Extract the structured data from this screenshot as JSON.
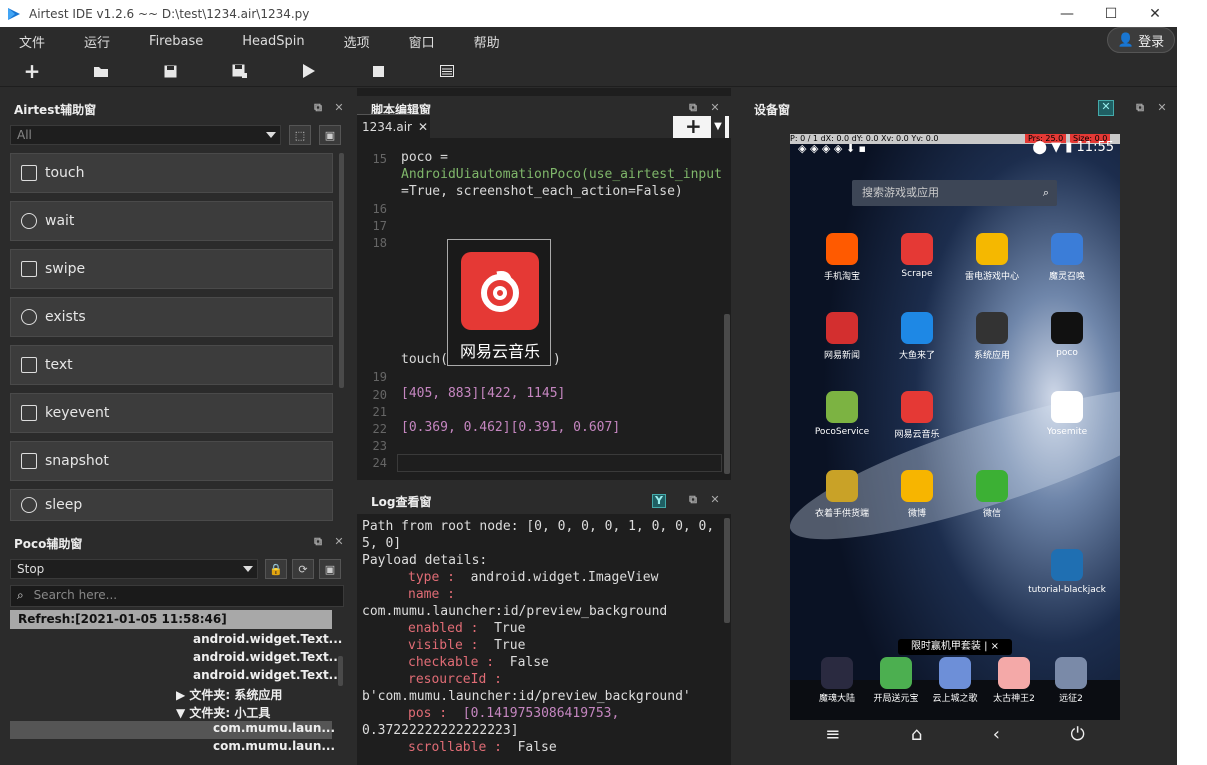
{
  "window": {
    "title": "Airtest IDE v1.2.6 ~~ D:\\test\\1234.air\\1234.py"
  },
  "menu": {
    "items": [
      "文件",
      "运行",
      "Firebase",
      "HeadSpin",
      "选项",
      "窗口",
      "帮助"
    ],
    "login": "登录"
  },
  "toolbar": {
    "icons": [
      "plus-icon",
      "folder-icon",
      "save-icon",
      "save-as-icon",
      "play-icon",
      "stop-icon",
      "list-icon"
    ]
  },
  "airtest_panel": {
    "title": "Airtest辅助窗",
    "filter": "All",
    "commands": [
      "touch",
      "wait",
      "swipe",
      "exists",
      "text",
      "keyevent",
      "snapshot",
      "sleep"
    ]
  },
  "poco_panel": {
    "title": "Poco辅助窗",
    "mode": "Stop",
    "search_placeholder": "Search here...",
    "refresh": "Refresh:[2021-01-05 11:58:46]",
    "tree": [
      "android.widget.Text...",
      "android.widget.Text...",
      "android.widget.Text...",
      "文件夹: 系统应用",
      "文件夹: 小工具",
      "com.mumu.laun...",
      "com.mumu.laun..."
    ]
  },
  "editor": {
    "title": "脚本编辑窗",
    "tab": "1234.air",
    "line_numbers": [
      "15",
      "16",
      "17",
      "18",
      "19",
      "20",
      "21",
      "22",
      "23",
      "24"
    ],
    "line15a": "poco =",
    "line15b": "AndroidUiautomationPoco(use_airtest_input",
    "line15c": "=True, screenshot_each_action=False)",
    "touch_call": "touch(",
    "touch_close": ")",
    "image_label": "网易云音乐",
    "line20": "[405, 883][422, 1145]",
    "line22": "[0.369, 0.462][0.391, 0.607]"
  },
  "log": {
    "title": "Log查看窗",
    "lines": [
      "Path from root node: [0, 0, 0, 0, 1, 0, 0, 0,",
      "5, 0]",
      "Payload details:"
    ],
    "type_key": "type :",
    "type_val": "android.widget.ImageView",
    "name_key": "name :",
    "name_val": "com.mumu.launcher:id/preview_background",
    "enabled_key": "enabled :",
    "enabled_val": "True",
    "visible_key": "visible :",
    "visible_val": "True",
    "checkable_key": "checkable :",
    "checkable_val": "False",
    "resource_key": "resourceId :",
    "resource_val": "b'com.mumu.launcher:id/preview_background'",
    "pos_key": "pos :",
    "pos_val": "[0.1419753086419753,",
    "pos_val2": "0.37222222222222223]",
    "scroll_key": "scrollable :",
    "scroll_val": "False"
  },
  "device": {
    "title": "设备窗",
    "debug": "P: 0 / 1   dX: 0.0   dY: 0.0   Xv: 0.0   Yv: 0.0",
    "prs": "Prs: 25.0",
    "size": "Size: 0.0",
    "clock": "11:55",
    "search_placeholder": "搜索游戏或应用",
    "apps": [
      {
        "label": "手机淘宝",
        "color": "#ff5a00"
      },
      {
        "label": "Scrape",
        "color": "#e53935"
      },
      {
        "label": "雷电游戏中心",
        "color": "#f5b800"
      },
      {
        "label": "魔灵召唤",
        "color": "#3b7dd8"
      },
      {
        "label": "网易新闻",
        "color": "#d32f2f"
      },
      {
        "label": "大鱼来了",
        "color": "#1e88e5"
      },
      {
        "label": "系统应用",
        "color": "#333333"
      },
      {
        "label": "poco",
        "color": "#111111"
      },
      {
        "label": "PocoService",
        "color": "#7cb342"
      },
      {
        "label": "网易云音乐",
        "color": "#e53935"
      },
      {
        "label": "",
        "color": "#111111"
      },
      {
        "label": "Yosemite",
        "color": "#ffffff"
      },
      {
        "label": "衣着手供货端",
        "color": "#c9a227"
      },
      {
        "label": "微博",
        "color": "#f7b500"
      },
      {
        "label": "微信",
        "color": "#3cb034"
      },
      {
        "label": "tutorial-blackjack",
        "color": "#1f6fb2"
      }
    ],
    "banner": "限时赢机甲套装  |  ×",
    "dock": [
      {
        "label": "魔魂大陆",
        "color": "#2a2a40"
      },
      {
        "label": "开局送元宝",
        "color": "#4caf50"
      },
      {
        "label": "云上城之歌",
        "color": "#6d8fd8"
      },
      {
        "label": "太古神王2",
        "color": "#f4a9a8"
      },
      {
        "label": "远征2",
        "color": "#7a8aa8"
      }
    ],
    "nav": [
      "menu-icon",
      "home-icon",
      "back-icon",
      "power-icon"
    ]
  }
}
